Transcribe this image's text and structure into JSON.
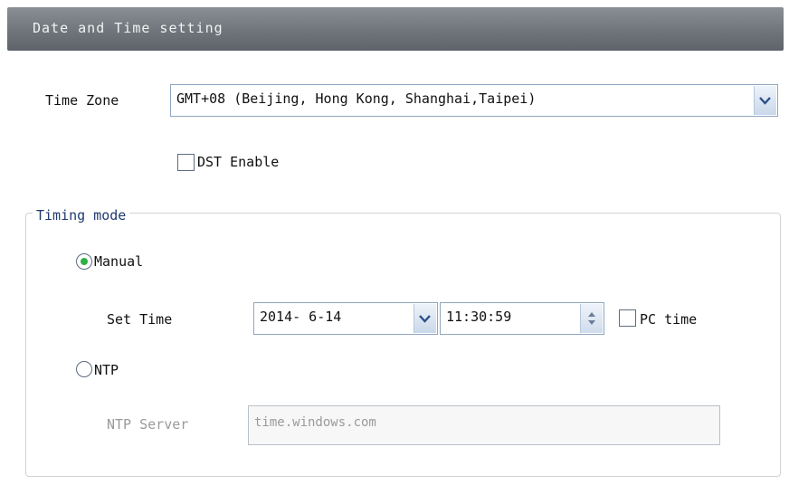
{
  "title": "Date and Time setting",
  "time_zone": {
    "label": "Time Zone",
    "value": "GMT+08 (Beijing, Hong Kong, Shanghai,Taipei)"
  },
  "dst": {
    "label": "DST Enable",
    "checked": false
  },
  "timing_mode": {
    "legend": "Timing mode",
    "manual": {
      "label": "Manual",
      "selected": true
    },
    "set_time": {
      "label": "Set Time",
      "date": "2014- 6-14",
      "time": "11:30:59",
      "pc_time_label": "PC time",
      "pc_time_checked": false
    },
    "ntp": {
      "label": "NTP",
      "selected": false
    },
    "ntp_server": {
      "label": "NTP Server",
      "value": "time.windows.com"
    }
  },
  "icons": {
    "dropdown": "chevron-down-icon",
    "spinner": "up-down-arrows-icon"
  },
  "colors": {
    "titlebar": "#6f757b",
    "radio_selected": "#2fb042",
    "legend_text": "#1e3a6e"
  }
}
